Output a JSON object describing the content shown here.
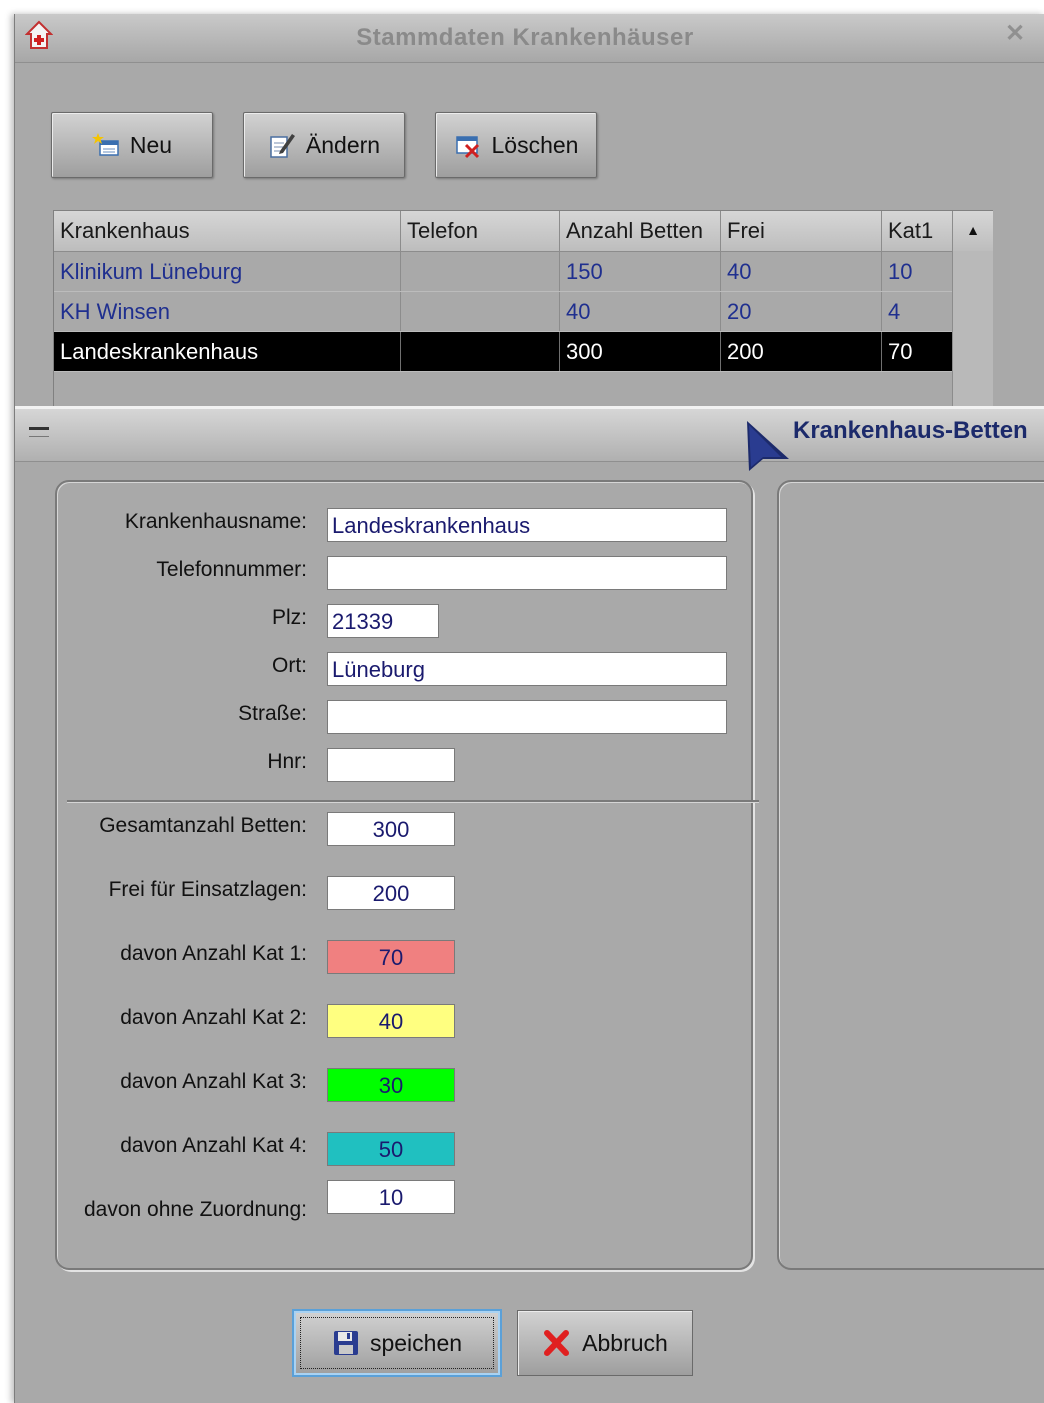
{
  "window": {
    "title": "Stammdaten Krankenhäuser",
    "app_icon": "hospital-icon",
    "close_icon": "close-icon"
  },
  "toolbar": {
    "new_label": "Neu",
    "edit_label": "Ändern",
    "delete_label": "Löschen"
  },
  "grid": {
    "columns": [
      "Krankenhaus",
      "Telefon",
      "Anzahl Betten",
      "Frei",
      "Kat1"
    ],
    "rows": [
      [
        "Klinikum Lüneburg",
        "",
        "150",
        "40",
        "10"
      ],
      [
        "KH Winsen",
        "",
        "40",
        "20",
        "4"
      ],
      [
        "Landeskrankenhaus",
        "",
        "300",
        "200",
        "70"
      ]
    ],
    "selected_row": 2
  },
  "splitter": {
    "title": "Krankenhaus-Betten"
  },
  "form": {
    "name_label": "Krankenhausname:",
    "name_value": "Landeskrankenhaus",
    "phone_label": "Telefonnummer:",
    "phone_value": "",
    "zip_label": "Plz:",
    "zip_value": "21339",
    "city_label": "Ort:",
    "city_value": "Lüneburg",
    "street_label": "Straße:",
    "street_value": "",
    "housenr_label": "Hnr:",
    "housenr_value": "",
    "total_beds_label": "Gesamtanzahl Betten:",
    "total_beds_value": "300",
    "free_label": "Frei für Einsatzlagen:",
    "free_value": "200",
    "kat1_label": "davon Anzahl Kat 1:",
    "kat1_value": "70",
    "kat2_label": "davon Anzahl Kat 2:",
    "kat2_value": "40",
    "kat3_label": "davon Anzahl Kat 3:",
    "kat3_value": "30",
    "kat4_label": "davon Anzahl Kat 4:",
    "kat4_value": "50",
    "unassigned_label": "davon ohne Zuordnung:",
    "unassigned_value": "10"
  },
  "colors": {
    "kat1": "#f08080",
    "kat2": "#ffff80",
    "kat3": "#00ff00",
    "kat4": "#20c0c0",
    "selection": "#000000",
    "title": "#1c2a6b"
  },
  "footer": {
    "save_label": "speichen",
    "cancel_label": "Abbruch"
  }
}
